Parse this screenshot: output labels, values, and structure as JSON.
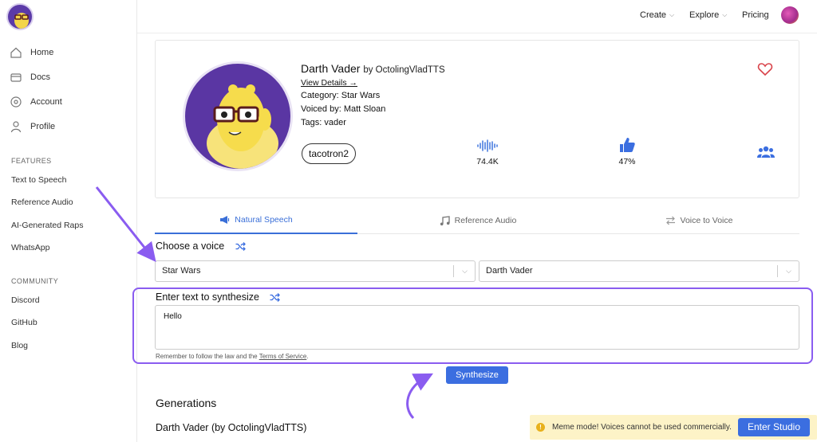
{
  "sidebar": {
    "nav": [
      {
        "label": "Home",
        "icon": "home-icon"
      },
      {
        "label": "Docs",
        "icon": "docs-icon"
      },
      {
        "label": "Account",
        "icon": "account-icon"
      },
      {
        "label": "Profile",
        "icon": "profile-icon"
      }
    ],
    "features_heading": "FEATURES",
    "features": [
      "Text to Speech",
      "Reference Audio",
      "AI-Generated Raps",
      "WhatsApp"
    ],
    "community_heading": "COMMUNITY",
    "community": [
      "Discord",
      "GitHub",
      "Blog"
    ]
  },
  "topbar": {
    "create": "Create",
    "explore": "Explore",
    "pricing": "Pricing"
  },
  "voice": {
    "name": "Darth Vader",
    "by": "by OctolingVladTTS",
    "view_details": "View Details →",
    "category": "Category: Star Wars",
    "voiced_by": "Voiced by: Matt Sloan",
    "tags": "Tags: vader",
    "model": "tacotron2",
    "plays": "74.4K",
    "likes": "47%"
  },
  "tabs": [
    {
      "label": "Natural Speech",
      "active": true
    },
    {
      "label": "Reference Audio",
      "active": false
    },
    {
      "label": "Voice to Voice",
      "active": false
    }
  ],
  "choose_voice": {
    "label": "Choose a voice",
    "category_value": "Star Wars",
    "voice_value": "Darth Vader"
  },
  "synth": {
    "label": "Enter text to synthesize",
    "text": "Hello",
    "notice": "Remember to follow the law and the ",
    "terms": "Terms of Service",
    "notice_end": ".",
    "button": "Synthesize"
  },
  "generations": {
    "heading": "Generations",
    "first_item": "Darth Vader (by OctolingVladTTS)"
  },
  "toast": {
    "text": "Meme mode! Voices cannot be used commercially.",
    "button": "Enter Studio"
  },
  "colors": {
    "accent": "#3b6ee0",
    "annotation": "#8a5cf0",
    "avatar_bg": "#5a36a3"
  }
}
